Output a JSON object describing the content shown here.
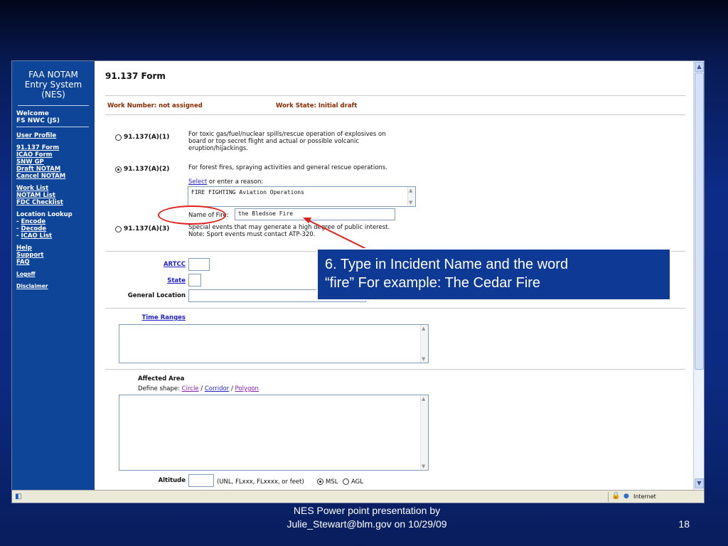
{
  "nav": {
    "title": [
      "FAA NOTAM",
      "Entry System",
      "(NES)"
    ],
    "welcome": [
      "Welcome",
      "FS NWC (JS)"
    ],
    "user_profile": "User Profile",
    "forms": [
      "91.137 Form",
      "ICAO Form",
      "SNW GP",
      "Draft NOTAM",
      "Cancel NOTAM"
    ],
    "lists": [
      "Work List",
      "NOTAM List",
      "FDC Checklist"
    ],
    "location_lookup": "Location Lookup",
    "lookup_items": [
      "Encode",
      "Decode",
      "ICAO List"
    ],
    "help": [
      "Help",
      "Support",
      "FAQ"
    ],
    "logoff": "Logoff",
    "disclaimer": "Disclaimer"
  },
  "form": {
    "title": "91.137 Form",
    "work_number": "Work Number: not assigned",
    "work_state": "Work State: Initial draft",
    "options": [
      {
        "label": "91.137(A)(1)",
        "desc": [
          "For toxic gas/fuel/nuclear spills/rescue operation of explosives on",
          "board or top secret flight and actual or possible volcanic",
          "eruption/hijackings."
        ],
        "checked": false
      },
      {
        "label": "91.137(A)(2)",
        "desc": [
          "For forest fires, spraying activities and general rescue operations."
        ],
        "checked": true
      },
      {
        "label": "91.137(A)(3)",
        "desc": [
          "Special events that may generate a high degree of public interest.",
          "Note: Sport events must contact ATP-320."
        ],
        "checked": false
      }
    ],
    "select_link": "Select",
    "reason_text": " or enter a reason:",
    "reason_value": "FIRE FIGHTING Aviation Operations",
    "name_of_fire_label": "Name of Fire:",
    "name_of_fire_value": "the Bledsoe Fire",
    "artcc_label": "ARTCC",
    "state_label": "State",
    "general_location_label": "General Location",
    "time_ranges_label": "Time Ranges",
    "affected_area_label": "Affected Area",
    "define_shape_text": "Define shape: ",
    "shape_links": [
      "Circle",
      "Corridor",
      "Polygon"
    ],
    "altitude_label": "Altitude",
    "altitude_hint": "(UNL, FLxxx, FLxxxx, or feet)",
    "msl_label": "MSL",
    "agl_label": "AGL",
    "altitude_ref_selected": "MSL"
  },
  "statusbar": {
    "zone": "Internet"
  },
  "callout": {
    "line1": "6.  Type in Incident Name and the word",
    "line2": "“fire” For example: The Cedar Fire"
  },
  "footer": {
    "line1": "NES Power point presentation by",
    "line2": "Julie_Stewart@blm.gov on 10/29/09",
    "page_number": "18"
  },
  "colors": {
    "nav_bg": "#0f4599",
    "status_text": "#8a2a00",
    "callout_bg": "#0e3a96",
    "annotation_red": "#e02020"
  }
}
